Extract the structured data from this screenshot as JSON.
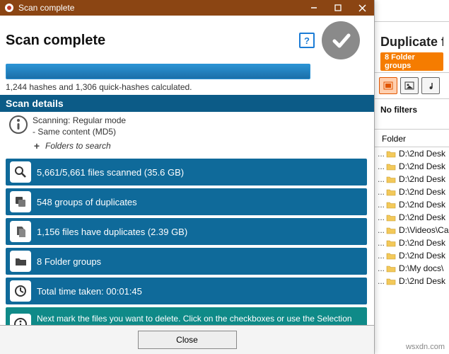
{
  "titlebar": {
    "title": "Scan complete"
  },
  "heading": "Scan complete",
  "hash_text": "1,244 hashes and 1,306 quick-hashes calculated.",
  "details_header": "Scan details",
  "scan_mode_line1": "Scanning: Regular mode",
  "scan_mode_line2": "- Same content (MD5)",
  "folders_to_search": "Folders to search",
  "stats": {
    "scanned": "5,661/5,661 files scanned (35.6 GB)",
    "groups": "548 groups of duplicates",
    "dups": "1,156 files have duplicates (2.39 GB)",
    "folders": "8 Folder groups",
    "time": "Total time taken: 00:01:45",
    "tip": "Next mark the files you want to delete. Click on the checkboxes or use the Selection Assistant."
  },
  "close_label": "Close",
  "bg": {
    "title": "Duplicate folders",
    "folder_groups": "8 Folder groups",
    "no_filters": "No filters",
    "folder_col": "Folder",
    "rows": [
      "D:\\2nd Desk",
      "D:\\2nd Desk",
      "D:\\2nd Desk",
      "D:\\2nd Desk",
      "D:\\2nd Desk",
      "D:\\2nd Desk",
      "D:\\Videos\\Ca",
      "D:\\2nd Desk",
      "D:\\2nd Desk",
      "D:\\My docs\\",
      "D:\\2nd Desk"
    ]
  },
  "watermark": "wsxdn.com"
}
